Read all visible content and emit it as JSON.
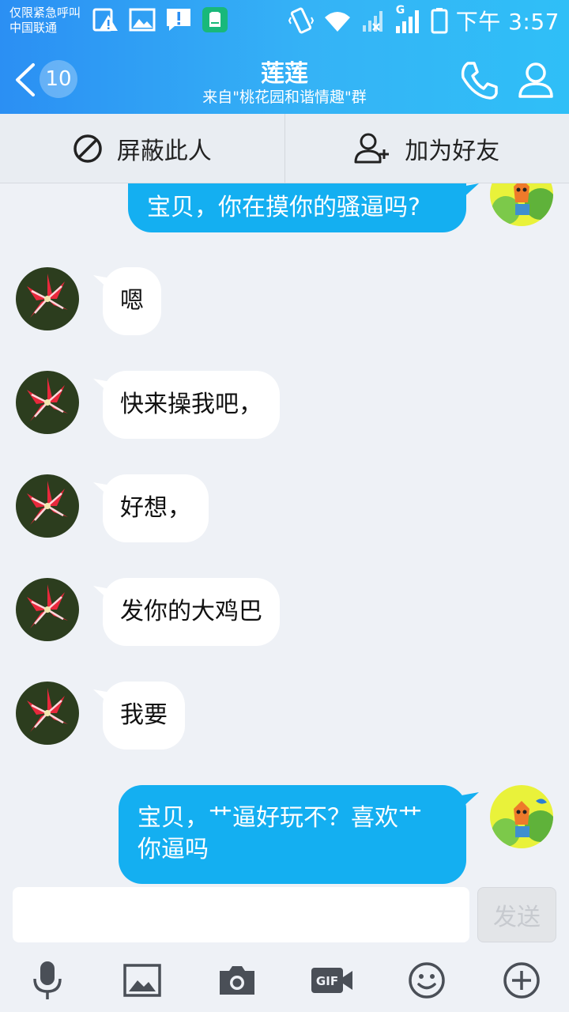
{
  "status_bar": {
    "carrier_line1": "仅限紧急呼叫",
    "carrier_line2": "中国联通",
    "network": "G",
    "time": "下午 3:57"
  },
  "header": {
    "back_badge": "10",
    "title": "莲莲",
    "subtitle": "来自\"桃花园和谐情趣\"群"
  },
  "actions": {
    "block_label": "屏蔽此人",
    "add_friend_label": "加为好友"
  },
  "messages": [
    {
      "side": "out",
      "text": "宝贝，你在摸你的骚逼吗?"
    },
    {
      "side": "in",
      "text": "嗯"
    },
    {
      "side": "in",
      "text": "快来操我吧，"
    },
    {
      "side": "in",
      "text": "好想，"
    },
    {
      "side": "in",
      "text": "发你的大鸡巴"
    },
    {
      "side": "in",
      "text": "我要"
    },
    {
      "side": "out",
      "line1": "宝贝，艹逼好玩不？喜欢艹",
      "line2": "你逼吗"
    }
  ],
  "composer": {
    "input_value": "",
    "send_label": "发送"
  },
  "toolbar": {
    "icons": [
      "microphone-icon",
      "image-icon",
      "camera-icon",
      "gif-icon",
      "emoji-icon",
      "plus-icon"
    ],
    "gif_text": "GIF"
  },
  "colors": {
    "header_start": "#2b8ff3",
    "header_end": "#2fbff7",
    "outgoing_bubble": "#14aff1",
    "incoming_bubble": "#ffffff",
    "chat_bg": "#eef1f6"
  }
}
